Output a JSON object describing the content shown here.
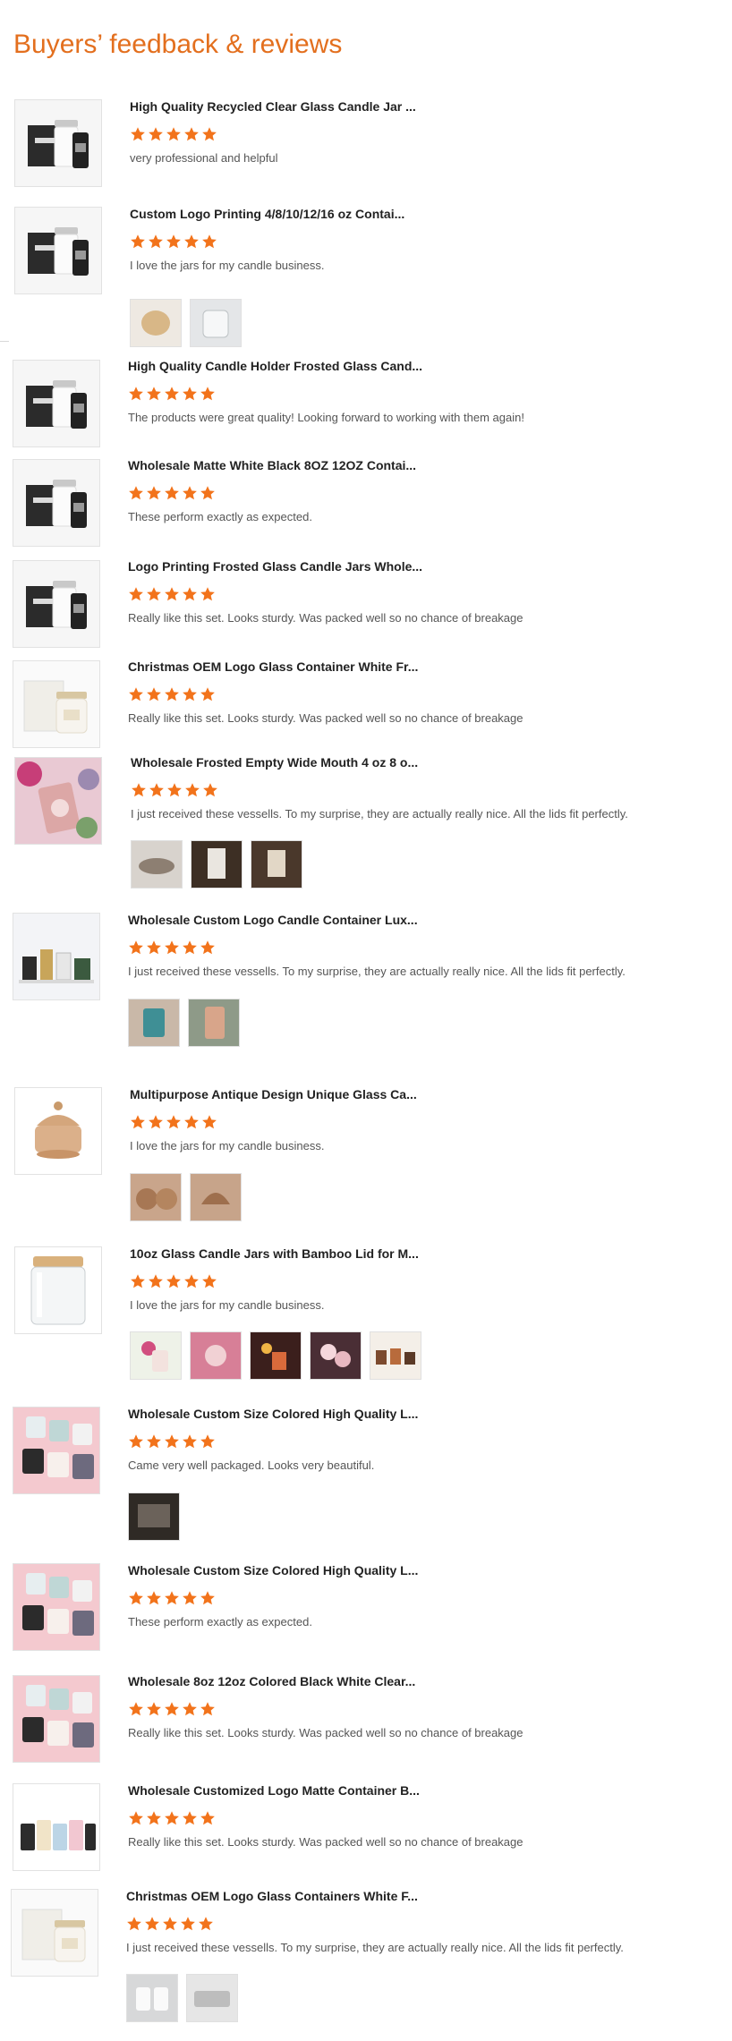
{
  "page": {
    "heading": "Buyers’ feedback & reviews",
    "accent_color": "#e36f1e",
    "star_color": "#f2731b"
  },
  "reviews": [
    {
      "title": "High Quality Recycled Clear Glass Candle Jar ...",
      "rating": 5,
      "comment": "very professional and helpful",
      "thumb": "black-white-candle-box",
      "photos": []
    },
    {
      "title": "Custom Logo Printing 4/8/10/12/16 oz Contai...",
      "rating": 5,
      "comment": "I love the jars for my candle business.",
      "thumb": "black-white-candle-box",
      "photos": [
        "bamboo-lid-jar-photo",
        "clear-jar-photo"
      ]
    },
    {
      "title": "High Quality Candle Holder Frosted Glass Cand...",
      "rating": 5,
      "comment": "The products were great quality! Looking forward to working with them again!",
      "thumb": "black-white-candle-box",
      "photos": []
    },
    {
      "title": "Wholesale Matte White Black 8OZ 12OZ Contai...",
      "rating": 5,
      "comment": "These perform exactly as expected.",
      "thumb": "black-white-candle-box",
      "photos": []
    },
    {
      "title": "Logo Printing Frosted Glass Candle Jars Whole...",
      "rating": 5,
      "comment": "Really like this set. Looks sturdy. Was packed well so no chance of breakage",
      "thumb": "black-white-candle-box",
      "photos": []
    },
    {
      "title": "Christmas OEM Logo Glass Container White Fr...",
      "rating": 5,
      "comment": "Really like this set. Looks sturdy. Was packed well so no chance of breakage",
      "thumb": "white-box-candle",
      "photos": []
    },
    {
      "title": "Wholesale Frosted Empty Wide Mouth 4 oz 8 o...",
      "rating": 5,
      "comment": "I just received these vessells. To my surprise, they are actually really nice. All the lids fit perfectly.",
      "thumb": "pink-floral-candles",
      "photos": [
        "jar-lid-photo",
        "box-photo",
        "candle-tin-photo"
      ]
    },
    {
      "title": "Wholesale Custom Logo Candle Container Lux...",
      "rating": 5,
      "comment": "I just received these vessells. To my surprise, they are actually really nice. All the lids fit perfectly.",
      "thumb": "luxury-candle-set",
      "photos": [
        "teal-jar-photo",
        "hand-jar-photo"
      ]
    },
    {
      "title": "Multipurpose Antique Design Unique Glass Ca...",
      "rating": 5,
      "comment": "I love the jars for my candle business.",
      "thumb": "amber-antique-jar",
      "photos": [
        "amber-jars-photo",
        "amber-jar-photo"
      ]
    },
    {
      "title": "10oz Glass Candle Jars with Bamboo Lid for M...",
      "rating": 5,
      "comment": "I love the jars for my candle business.",
      "thumb": "clear-bamboo-jar",
      "photos": [
        "flower-candle-photo",
        "rose-candle-photo",
        "dark-candle-photo",
        "pink-candles-photo",
        "candle-shelf-photo"
      ]
    },
    {
      "title": "Wholesale Custom Size Colored High Quality L...",
      "rating": 5,
      "comment": "Came very well packaged. Looks very beautiful.",
      "thumb": "colored-jars-pink",
      "photos": [
        "packaging-photo"
      ]
    },
    {
      "title": "Wholesale Custom Size Colored High Quality L...",
      "rating": 5,
      "comment": "These perform exactly as expected.",
      "thumb": "colored-jars-pink",
      "photos": []
    },
    {
      "title": "Wholesale 8oz 12oz Colored Black White Clear...",
      "rating": 5,
      "comment": "Really like this set. Looks sturdy. Was packed well so no chance of breakage",
      "thumb": "colored-jars-pink",
      "photos": []
    },
    {
      "title": "Wholesale Customized Logo Matte Container B...",
      "rating": 5,
      "comment": "Really like this set. Looks sturdy. Was packed well so no chance of breakage",
      "thumb": "colored-jar-row",
      "photos": []
    },
    {
      "title": "Christmas OEM Logo Glass Containers White F...",
      "rating": 5,
      "comment": "I just received these vessells. To my surprise, they are actually really nice. All the lids fit perfectly.",
      "thumb": "white-box-candle",
      "photos": [
        "white-candles-photo",
        "white-jars-photo"
      ]
    }
  ]
}
